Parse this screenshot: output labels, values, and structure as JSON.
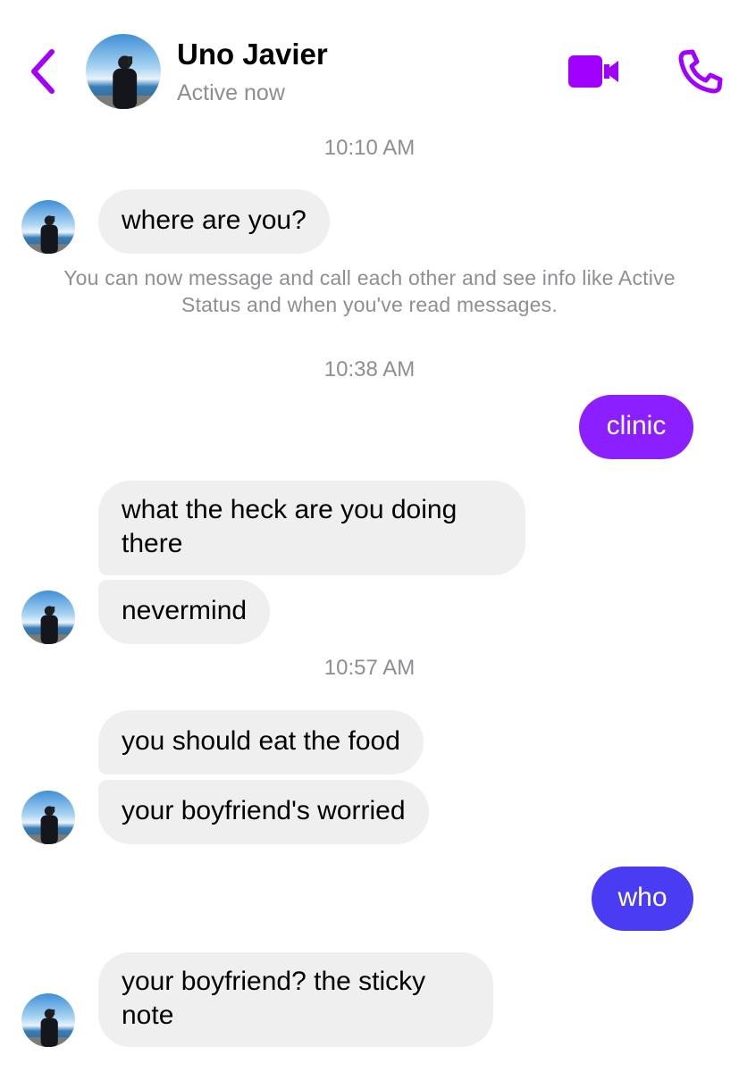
{
  "header": {
    "contact_name": "Uno Javier",
    "status": "Active now",
    "accent_color": "#a100ff",
    "icons": [
      "chevron-left-icon",
      "avatar",
      "video-camera-icon",
      "phone-icon"
    ]
  },
  "conversation": {
    "timestamps": [
      "10:10 AM",
      "10:38 AM",
      "10:57 AM"
    ],
    "notice": "You can now message and call each other and see info like Active Status and when you've read messages.",
    "messages": [
      {
        "from": "contact",
        "text": "where are you?"
      },
      {
        "from": "me",
        "text": "clinic",
        "color": "#8b1fff"
      },
      {
        "from": "contact",
        "text": "what the heck are you doing there"
      },
      {
        "from": "contact",
        "text": "nevermind"
      },
      {
        "from": "contact",
        "text": "you should eat the food"
      },
      {
        "from": "contact",
        "text": "your boyfriend's worried"
      },
      {
        "from": "me",
        "text": "who",
        "color": "#4a3cf2"
      },
      {
        "from": "contact",
        "text": "your boyfriend? the sticky note"
      }
    ]
  }
}
